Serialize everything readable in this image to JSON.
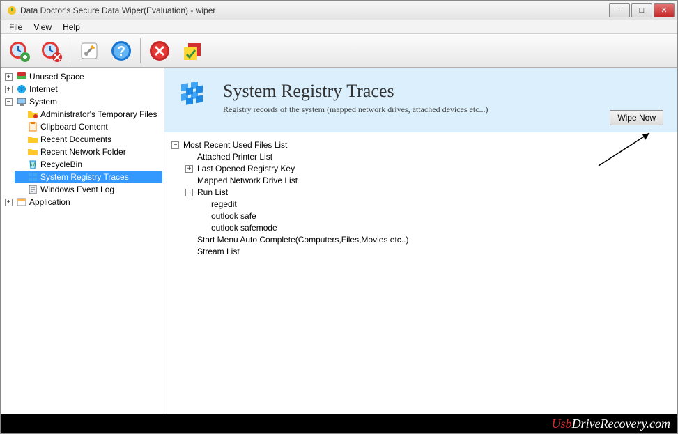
{
  "window": {
    "title": "Data Doctor's Secure Data Wiper(Evaluation) - wiper"
  },
  "menu": {
    "file": "File",
    "view": "View",
    "help": "Help"
  },
  "tree": {
    "unused_space": "Unused Space",
    "internet": "Internet",
    "system": "System",
    "system_children": {
      "admin_temp": "Administrator's Temporary Files",
      "clipboard": "Clipboard Content",
      "recent_docs": "Recent Documents",
      "recent_net": "Recent Network Folder",
      "recycle": "RecycleBin",
      "registry": "System Registry Traces",
      "eventlog": "Windows Event Log"
    },
    "application": "Application"
  },
  "header": {
    "title": "System Registry Traces",
    "subtitle": "Registry records of the system (mapped network drives, attached devices etc...)",
    "wipe_btn": "Wipe Now"
  },
  "details": {
    "mru": "Most Recent Used Files List",
    "printer": "Attached Printer List",
    "lastreg": "Last Opened Registry Key",
    "mapped": "Mapped Network Drive List",
    "runlist": "Run List",
    "run_items": {
      "regedit": "regedit",
      "outlook_safe": "outlook safe",
      "outlook_safemode": "outlook safemode"
    },
    "startmenu": "Start Menu Auto Complete(Computers,Files,Movies etc..)",
    "stream": "Stream List"
  },
  "footer": {
    "brand_prefix": "Usb",
    "brand_rest": "DriveRecovery.com"
  }
}
